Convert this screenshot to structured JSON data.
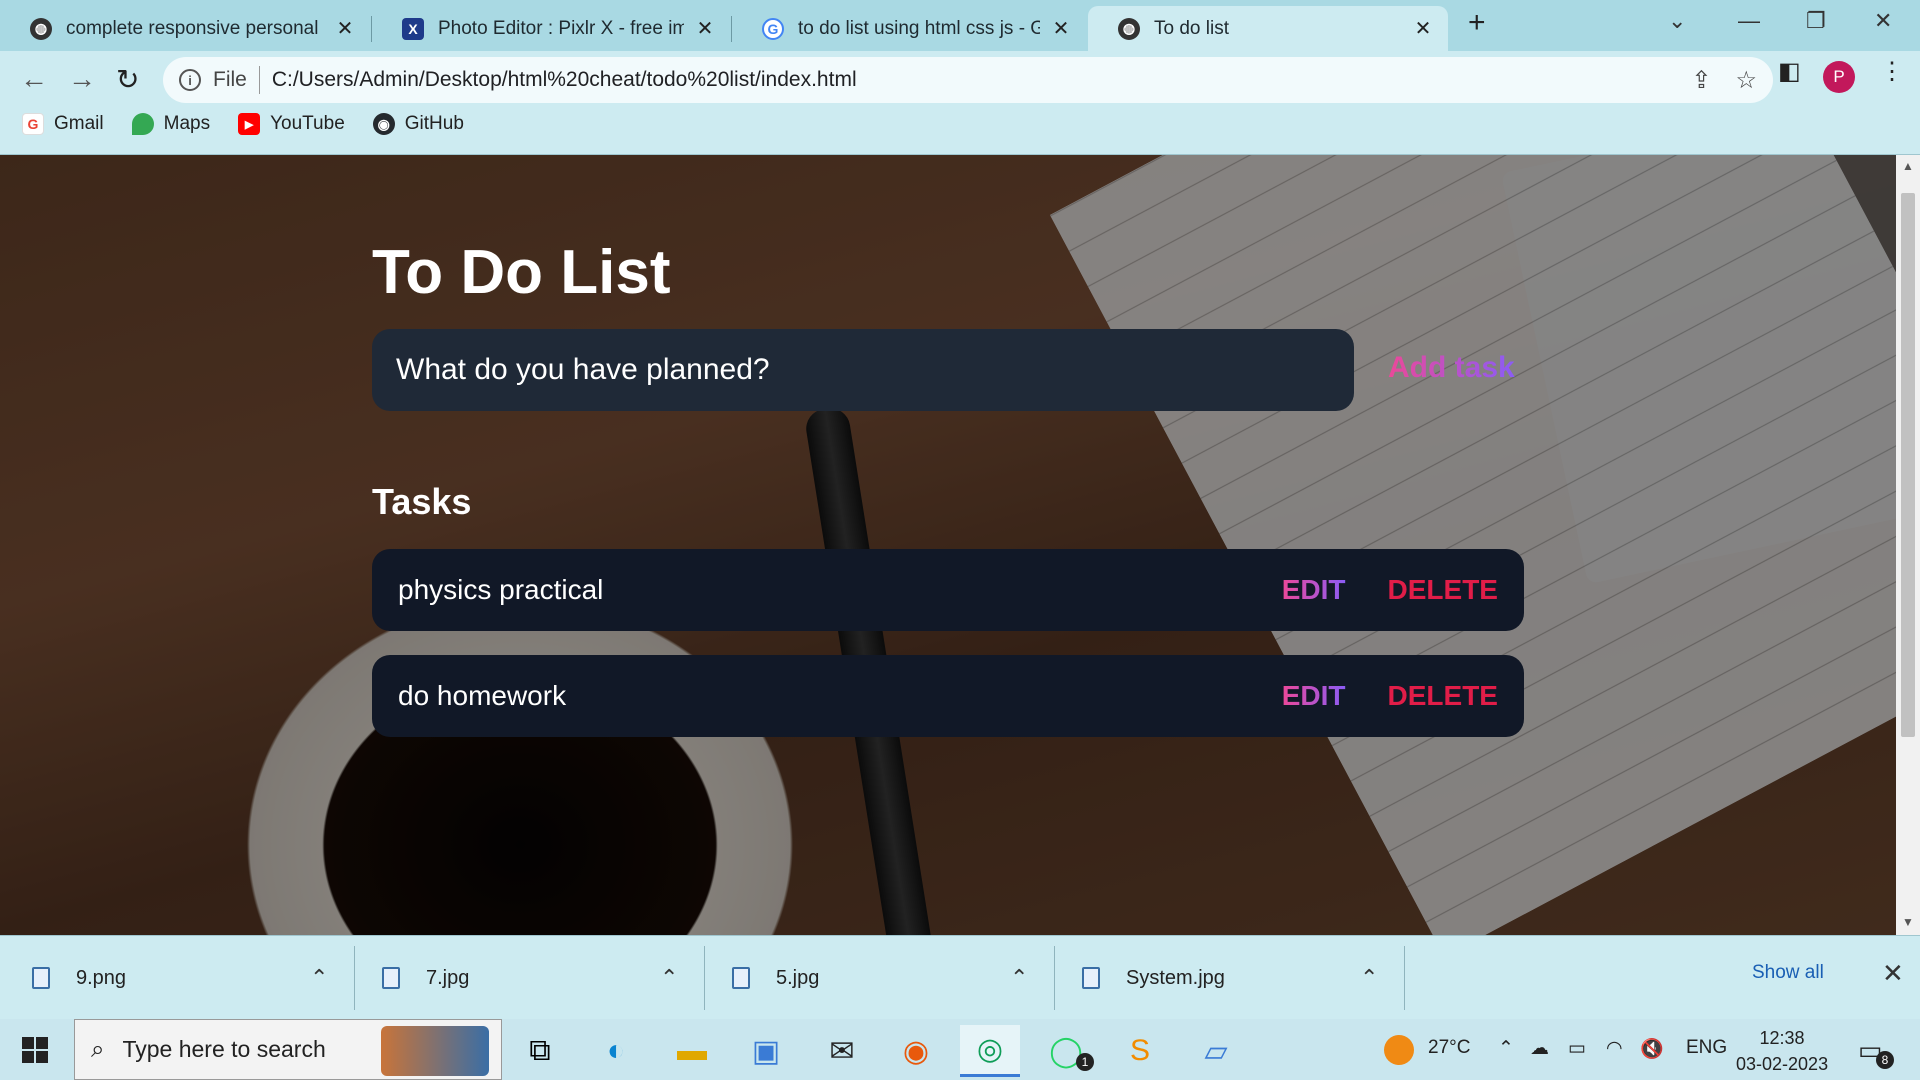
{
  "browser": {
    "tabs": [
      {
        "title": "complete responsive personal po",
        "active": false,
        "favicon": "globe-icon"
      },
      {
        "title": "Photo Editor : Pixlr X - free image",
        "active": false,
        "favicon": "pixlr-icon"
      },
      {
        "title": "to do list using html css js - Goog",
        "active": false,
        "favicon": "google-icon"
      },
      {
        "title": "To do list",
        "active": true,
        "favicon": "globe-icon"
      }
    ],
    "new_tab": "+",
    "address": {
      "scheme_label": "File",
      "url": "C:/Users/Admin/Desktop/html%20cheat/todo%20list/index.html"
    },
    "profile_initial": "P",
    "bookmarks": [
      {
        "label": "Gmail",
        "icon": "gmail-icon",
        "color": "#ea4335"
      },
      {
        "label": "Maps",
        "icon": "maps-icon",
        "color": "#34a853"
      },
      {
        "label": "YouTube",
        "icon": "youtube-icon",
        "color": "#ff0000"
      },
      {
        "label": "GitHub",
        "icon": "github-icon",
        "color": "#24292e"
      }
    ]
  },
  "app": {
    "title": "To Do List",
    "input_placeholder": "What do you have planned?",
    "add_button": "Add task",
    "tasks_heading": "Tasks",
    "tasks": [
      {
        "text": "physics practical",
        "edit": "EDIT",
        "delete": "DELETE"
      },
      {
        "text": "do homework",
        "edit": "EDIT",
        "delete": "DELETE"
      }
    ],
    "colors": {
      "input_bg": "#1f2937",
      "task_bg": "#111827",
      "accent_gradient_start": "#ec4899",
      "accent_gradient_end": "#8b5cf6",
      "delete": "#e11d48"
    }
  },
  "downloads": {
    "items": [
      {
        "name": "9.png"
      },
      {
        "name": "7.jpg"
      },
      {
        "name": "5.jpg"
      },
      {
        "name": "System.jpg"
      }
    ],
    "show_all": "Show all"
  },
  "taskbar": {
    "search_placeholder": "Type here to search",
    "weather": "27°C",
    "language": "ENG",
    "time": "12:38",
    "date": "03-02-2023",
    "notification_count": "8",
    "whatsapp_badge": "1"
  }
}
